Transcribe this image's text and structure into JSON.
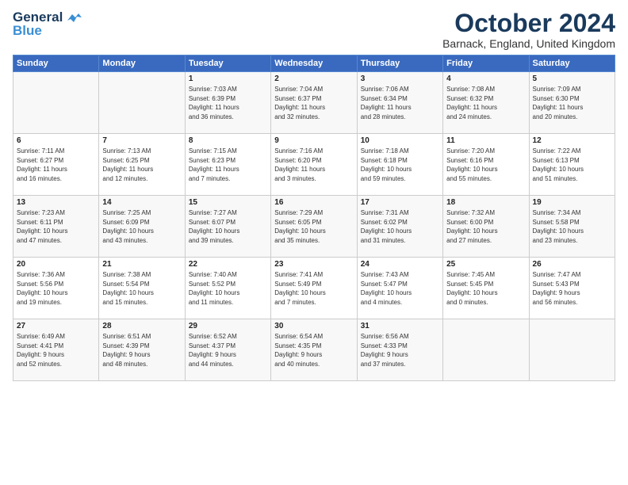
{
  "logo": {
    "line1": "General",
    "line2": "Blue"
  },
  "header": {
    "month": "October 2024",
    "location": "Barnack, England, United Kingdom"
  },
  "days_of_week": [
    "Sunday",
    "Monday",
    "Tuesday",
    "Wednesday",
    "Thursday",
    "Friday",
    "Saturday"
  ],
  "weeks": [
    [
      {
        "day": "",
        "content": ""
      },
      {
        "day": "",
        "content": ""
      },
      {
        "day": "1",
        "content": "Sunrise: 7:03 AM\nSunset: 6:39 PM\nDaylight: 11 hours\nand 36 minutes."
      },
      {
        "day": "2",
        "content": "Sunrise: 7:04 AM\nSunset: 6:37 PM\nDaylight: 11 hours\nand 32 minutes."
      },
      {
        "day": "3",
        "content": "Sunrise: 7:06 AM\nSunset: 6:34 PM\nDaylight: 11 hours\nand 28 minutes."
      },
      {
        "day": "4",
        "content": "Sunrise: 7:08 AM\nSunset: 6:32 PM\nDaylight: 11 hours\nand 24 minutes."
      },
      {
        "day": "5",
        "content": "Sunrise: 7:09 AM\nSunset: 6:30 PM\nDaylight: 11 hours\nand 20 minutes."
      }
    ],
    [
      {
        "day": "6",
        "content": "Sunrise: 7:11 AM\nSunset: 6:27 PM\nDaylight: 11 hours\nand 16 minutes."
      },
      {
        "day": "7",
        "content": "Sunrise: 7:13 AM\nSunset: 6:25 PM\nDaylight: 11 hours\nand 12 minutes."
      },
      {
        "day": "8",
        "content": "Sunrise: 7:15 AM\nSunset: 6:23 PM\nDaylight: 11 hours\nand 7 minutes."
      },
      {
        "day": "9",
        "content": "Sunrise: 7:16 AM\nSunset: 6:20 PM\nDaylight: 11 hours\nand 3 minutes."
      },
      {
        "day": "10",
        "content": "Sunrise: 7:18 AM\nSunset: 6:18 PM\nDaylight: 10 hours\nand 59 minutes."
      },
      {
        "day": "11",
        "content": "Sunrise: 7:20 AM\nSunset: 6:16 PM\nDaylight: 10 hours\nand 55 minutes."
      },
      {
        "day": "12",
        "content": "Sunrise: 7:22 AM\nSunset: 6:13 PM\nDaylight: 10 hours\nand 51 minutes."
      }
    ],
    [
      {
        "day": "13",
        "content": "Sunrise: 7:23 AM\nSunset: 6:11 PM\nDaylight: 10 hours\nand 47 minutes."
      },
      {
        "day": "14",
        "content": "Sunrise: 7:25 AM\nSunset: 6:09 PM\nDaylight: 10 hours\nand 43 minutes."
      },
      {
        "day": "15",
        "content": "Sunrise: 7:27 AM\nSunset: 6:07 PM\nDaylight: 10 hours\nand 39 minutes."
      },
      {
        "day": "16",
        "content": "Sunrise: 7:29 AM\nSunset: 6:05 PM\nDaylight: 10 hours\nand 35 minutes."
      },
      {
        "day": "17",
        "content": "Sunrise: 7:31 AM\nSunset: 6:02 PM\nDaylight: 10 hours\nand 31 minutes."
      },
      {
        "day": "18",
        "content": "Sunrise: 7:32 AM\nSunset: 6:00 PM\nDaylight: 10 hours\nand 27 minutes."
      },
      {
        "day": "19",
        "content": "Sunrise: 7:34 AM\nSunset: 5:58 PM\nDaylight: 10 hours\nand 23 minutes."
      }
    ],
    [
      {
        "day": "20",
        "content": "Sunrise: 7:36 AM\nSunset: 5:56 PM\nDaylight: 10 hours\nand 19 minutes."
      },
      {
        "day": "21",
        "content": "Sunrise: 7:38 AM\nSunset: 5:54 PM\nDaylight: 10 hours\nand 15 minutes."
      },
      {
        "day": "22",
        "content": "Sunrise: 7:40 AM\nSunset: 5:52 PM\nDaylight: 10 hours\nand 11 minutes."
      },
      {
        "day": "23",
        "content": "Sunrise: 7:41 AM\nSunset: 5:49 PM\nDaylight: 10 hours\nand 7 minutes."
      },
      {
        "day": "24",
        "content": "Sunrise: 7:43 AM\nSunset: 5:47 PM\nDaylight: 10 hours\nand 4 minutes."
      },
      {
        "day": "25",
        "content": "Sunrise: 7:45 AM\nSunset: 5:45 PM\nDaylight: 10 hours\nand 0 minutes."
      },
      {
        "day": "26",
        "content": "Sunrise: 7:47 AM\nSunset: 5:43 PM\nDaylight: 9 hours\nand 56 minutes."
      }
    ],
    [
      {
        "day": "27",
        "content": "Sunrise: 6:49 AM\nSunset: 4:41 PM\nDaylight: 9 hours\nand 52 minutes."
      },
      {
        "day": "28",
        "content": "Sunrise: 6:51 AM\nSunset: 4:39 PM\nDaylight: 9 hours\nand 48 minutes."
      },
      {
        "day": "29",
        "content": "Sunrise: 6:52 AM\nSunset: 4:37 PM\nDaylight: 9 hours\nand 44 minutes."
      },
      {
        "day": "30",
        "content": "Sunrise: 6:54 AM\nSunset: 4:35 PM\nDaylight: 9 hours\nand 40 minutes."
      },
      {
        "day": "31",
        "content": "Sunrise: 6:56 AM\nSunset: 4:33 PM\nDaylight: 9 hours\nand 37 minutes."
      },
      {
        "day": "",
        "content": ""
      },
      {
        "day": "",
        "content": ""
      }
    ]
  ]
}
